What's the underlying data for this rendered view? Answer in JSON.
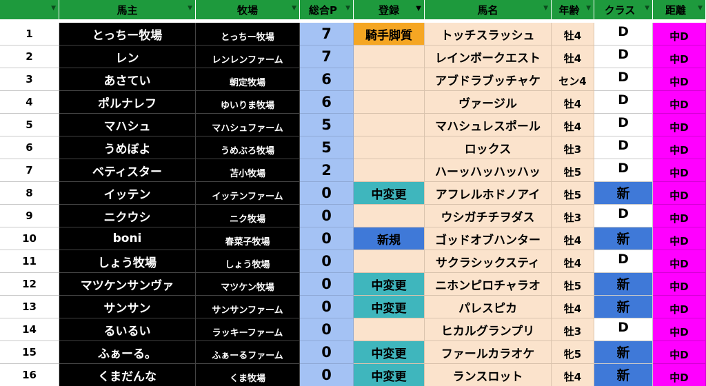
{
  "columns": [
    {
      "key": "number",
      "label": "",
      "filter_active": false
    },
    {
      "key": "owner",
      "label": "馬主",
      "filter_active": false
    },
    {
      "key": "farm",
      "label": "牧場",
      "filter_active": false
    },
    {
      "key": "points",
      "label": "総合P",
      "filter_active": false
    },
    {
      "key": "registration",
      "label": "登録",
      "filter_active": true
    },
    {
      "key": "horse",
      "label": "馬名",
      "filter_active": false
    },
    {
      "key": "age",
      "label": "年齢",
      "filter_active": false
    },
    {
      "key": "class",
      "label": "クラス",
      "filter_active": false
    },
    {
      "key": "distance",
      "label": "距離",
      "filter_active": false
    }
  ],
  "icons": {
    "filter": "filter-dropdown-icon",
    "filter_active": "filter-active-icon"
  },
  "colors": {
    "header_bg": "#1e9a3d",
    "owner_bg": "#000000",
    "points_bg": "#a4c2f4",
    "horse_bg": "#fbe3cc",
    "reg_jockey": "#f5a623",
    "reg_change": "#3fb6bd",
    "reg_new": "#3f79d8",
    "class_new": "#3f79d8",
    "distance_bg": "#ff00ff"
  },
  "rows": [
    {
      "number": "1",
      "owner": "とっちー牧場",
      "farm": "とっちー牧場",
      "points": "7",
      "registration": "騎手脚質",
      "reg_type": "jockey",
      "horse": "トッチスラッシュ",
      "age": "牡4",
      "class": "D",
      "distance": "中D"
    },
    {
      "number": "2",
      "owner": "レン",
      "farm": "レンレンファーム",
      "points": "7",
      "registration": "",
      "reg_type": "",
      "horse": "レインボークエスト",
      "age": "牡4",
      "class": "D",
      "distance": "中D"
    },
    {
      "number": "3",
      "owner": "あさてい",
      "farm": "朝定牧場",
      "points": "6",
      "registration": "",
      "reg_type": "",
      "horse": "アブドラブッチャケ",
      "age": "セン4",
      "class": "D",
      "distance": "中D"
    },
    {
      "number": "4",
      "owner": "ポルナレフ",
      "farm": "ゆいりま牧場",
      "points": "6",
      "registration": "",
      "reg_type": "",
      "horse": "ヴァージル",
      "age": "牡4",
      "class": "D",
      "distance": "中D"
    },
    {
      "number": "5",
      "owner": "マハシュ",
      "farm": "マハシュファーム",
      "points": "5",
      "registration": "",
      "reg_type": "",
      "horse": "マハシュレスポール",
      "age": "牡4",
      "class": "D",
      "distance": "中D"
    },
    {
      "number": "6",
      "owner": "うめぼよ",
      "farm": "うめぶろ牧場",
      "points": "5",
      "registration": "",
      "reg_type": "",
      "horse": "ロックス",
      "age": "牡3",
      "class": "D",
      "distance": "中D"
    },
    {
      "number": "7",
      "owner": "ベティスター",
      "farm": "苫小牧場",
      "points": "2",
      "registration": "",
      "reg_type": "",
      "horse": "ハーッハッハッハッ",
      "age": "牡5",
      "class": "D",
      "distance": "中D"
    },
    {
      "number": "8",
      "owner": "イッテン",
      "farm": "イッテンファーム",
      "points": "0",
      "registration": "中変更",
      "reg_type": "change",
      "horse": "アフレルホドノアイ",
      "age": "牡5",
      "class": "新",
      "distance": "中D"
    },
    {
      "number": "9",
      "owner": "ニクウシ",
      "farm": "ニク牧場",
      "points": "0",
      "registration": "",
      "reg_type": "",
      "horse": "ウシガチチヲダス",
      "age": "牡3",
      "class": "D",
      "distance": "中D"
    },
    {
      "number": "10",
      "owner": "boni",
      "farm": "春菜子牧場",
      "points": "0",
      "registration": "新規",
      "reg_type": "new",
      "horse": "ゴッドオブハンター",
      "age": "牡4",
      "class": "新",
      "distance": "中D"
    },
    {
      "number": "11",
      "owner": "しょう牧場",
      "farm": "しょう牧場",
      "points": "0",
      "registration": "",
      "reg_type": "",
      "horse": "サクラシックスティ",
      "age": "牡4",
      "class": "D",
      "distance": "中D"
    },
    {
      "number": "12",
      "owner": "マツケンサンヴァ",
      "farm": "マツケン牧場",
      "points": "0",
      "registration": "中変更",
      "reg_type": "change",
      "horse": "ニホンピロチャラオ",
      "age": "牡5",
      "class": "新",
      "distance": "中D"
    },
    {
      "number": "13",
      "owner": "サンサン",
      "farm": "サンサンファーム",
      "points": "0",
      "registration": "中変更",
      "reg_type": "change",
      "horse": "パレスピカ",
      "age": "牡4",
      "class": "新",
      "distance": "中D"
    },
    {
      "number": "14",
      "owner": "るいるい",
      "farm": "ラッキーファーム",
      "points": "0",
      "registration": "",
      "reg_type": "",
      "horse": "ヒカルグランプリ",
      "age": "牡3",
      "class": "D",
      "distance": "中D"
    },
    {
      "number": "15",
      "owner": "ふぁーる。",
      "farm": "ふぁーるファーム",
      "points": "0",
      "registration": "中変更",
      "reg_type": "change",
      "horse": "ファールカラオケ",
      "age": "牝5",
      "class": "新",
      "distance": "中D"
    },
    {
      "number": "16",
      "owner": "くまだんな",
      "farm": "くま牧場",
      "points": "0",
      "registration": "中変更",
      "reg_type": "change",
      "horse": "ランスロット",
      "age": "牡4",
      "class": "新",
      "distance": "中D"
    }
  ]
}
